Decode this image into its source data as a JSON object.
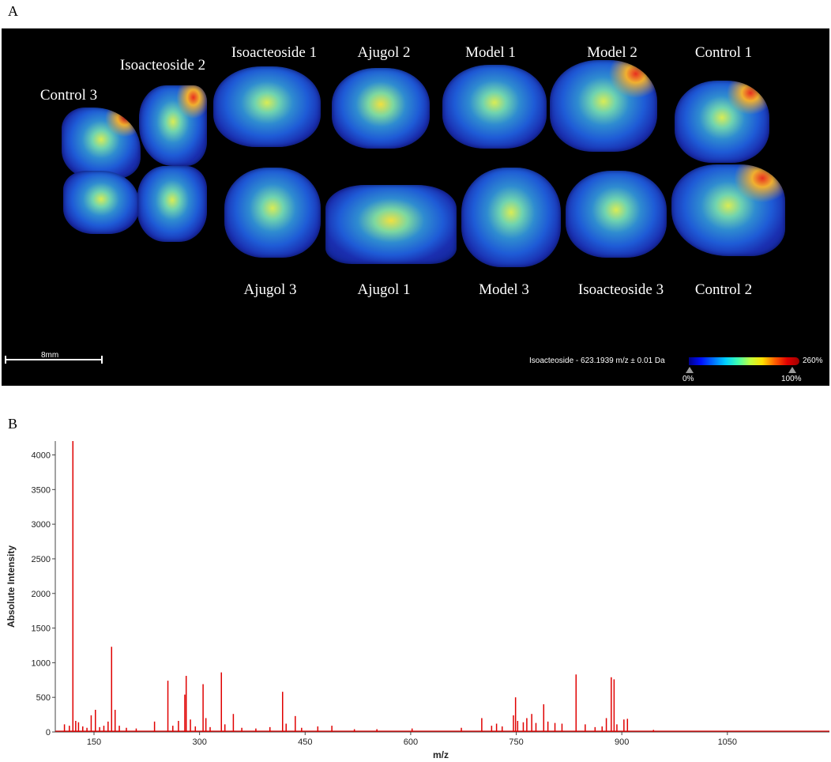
{
  "panel_a": {
    "letter": "A",
    "slices": [
      {
        "label": "Control 3"
      },
      {
        "label": "Isoacteoside 2"
      },
      {
        "label": "Isoacteoside 1"
      },
      {
        "label": "Ajugol 2"
      },
      {
        "label": "Model 1"
      },
      {
        "label": "Model 2"
      },
      {
        "label": "Control 1"
      },
      {
        "label": "Ajugol 3"
      },
      {
        "label": "Ajugol 1"
      },
      {
        "label": "Model 3"
      },
      {
        "label": "Isoacteoside 3"
      },
      {
        "label": "Control 2"
      }
    ],
    "scale_bar": "8mm",
    "colorbar": {
      "title": "Isoacteoside - 623.1939 m/z ± 0.01 Da",
      "max_label": "260%",
      "tick_low": "0%",
      "tick_high": "100%",
      "colors": [
        "#00008a",
        "#0010ff",
        "#00d0ff",
        "#ffe000",
        "#e00000"
      ]
    }
  },
  "panel_b": {
    "letter": "B"
  },
  "chart_data": {
    "type": "line",
    "title": "",
    "xlabel": "m/z",
    "ylabel": "Absolute Intensity",
    "xlim": [
      95,
      1195
    ],
    "ylim": [
      0,
      4200
    ],
    "xticks": [
      150,
      300,
      450,
      600,
      750,
      900,
      1050
    ],
    "yticks": [
      0,
      500,
      1000,
      1500,
      2000,
      2500,
      3000,
      3500,
      4000
    ],
    "series": [
      {
        "color": "#e00000",
        "peaks": [
          [
            108,
            110
          ],
          [
            115,
            90
          ],
          [
            120,
            4200
          ],
          [
            124,
            160
          ],
          [
            128,
            140
          ],
          [
            134,
            80
          ],
          [
            140,
            60
          ],
          [
            146,
            240
          ],
          [
            152,
            320
          ],
          [
            158,
            70
          ],
          [
            164,
            90
          ],
          [
            170,
            150
          ],
          [
            175,
            1230
          ],
          [
            180,
            320
          ],
          [
            186,
            90
          ],
          [
            196,
            60
          ],
          [
            210,
            50
          ],
          [
            236,
            150
          ],
          [
            255,
            740
          ],
          [
            262,
            90
          ],
          [
            270,
            160
          ],
          [
            279,
            540
          ],
          [
            281,
            810
          ],
          [
            287,
            180
          ],
          [
            294,
            80
          ],
          [
            305,
            690
          ],
          [
            309,
            200
          ],
          [
            315,
            70
          ],
          [
            331,
            860
          ],
          [
            336,
            110
          ],
          [
            348,
            260
          ],
          [
            360,
            60
          ],
          [
            380,
            50
          ],
          [
            400,
            70
          ],
          [
            418,
            580
          ],
          [
            423,
            120
          ],
          [
            436,
            230
          ],
          [
            445,
            60
          ],
          [
            468,
            80
          ],
          [
            488,
            90
          ],
          [
            520,
            40
          ],
          [
            552,
            40
          ],
          [
            602,
            50
          ],
          [
            672,
            60
          ],
          [
            701,
            200
          ],
          [
            715,
            90
          ],
          [
            722,
            120
          ],
          [
            730,
            80
          ],
          [
            746,
            240
          ],
          [
            749,
            500
          ],
          [
            752,
            160
          ],
          [
            760,
            140
          ],
          [
            765,
            200
          ],
          [
            772,
            260
          ],
          [
            778,
            130
          ],
          [
            789,
            400
          ],
          [
            795,
            150
          ],
          [
            805,
            130
          ],
          [
            815,
            120
          ],
          [
            835,
            830
          ],
          [
            848,
            110
          ],
          [
            862,
            70
          ],
          [
            872,
            80
          ],
          [
            878,
            200
          ],
          [
            885,
            790
          ],
          [
            889,
            760
          ],
          [
            893,
            110
          ],
          [
            903,
            180
          ],
          [
            908,
            190
          ],
          [
            945,
            30
          ]
        ]
      }
    ]
  }
}
